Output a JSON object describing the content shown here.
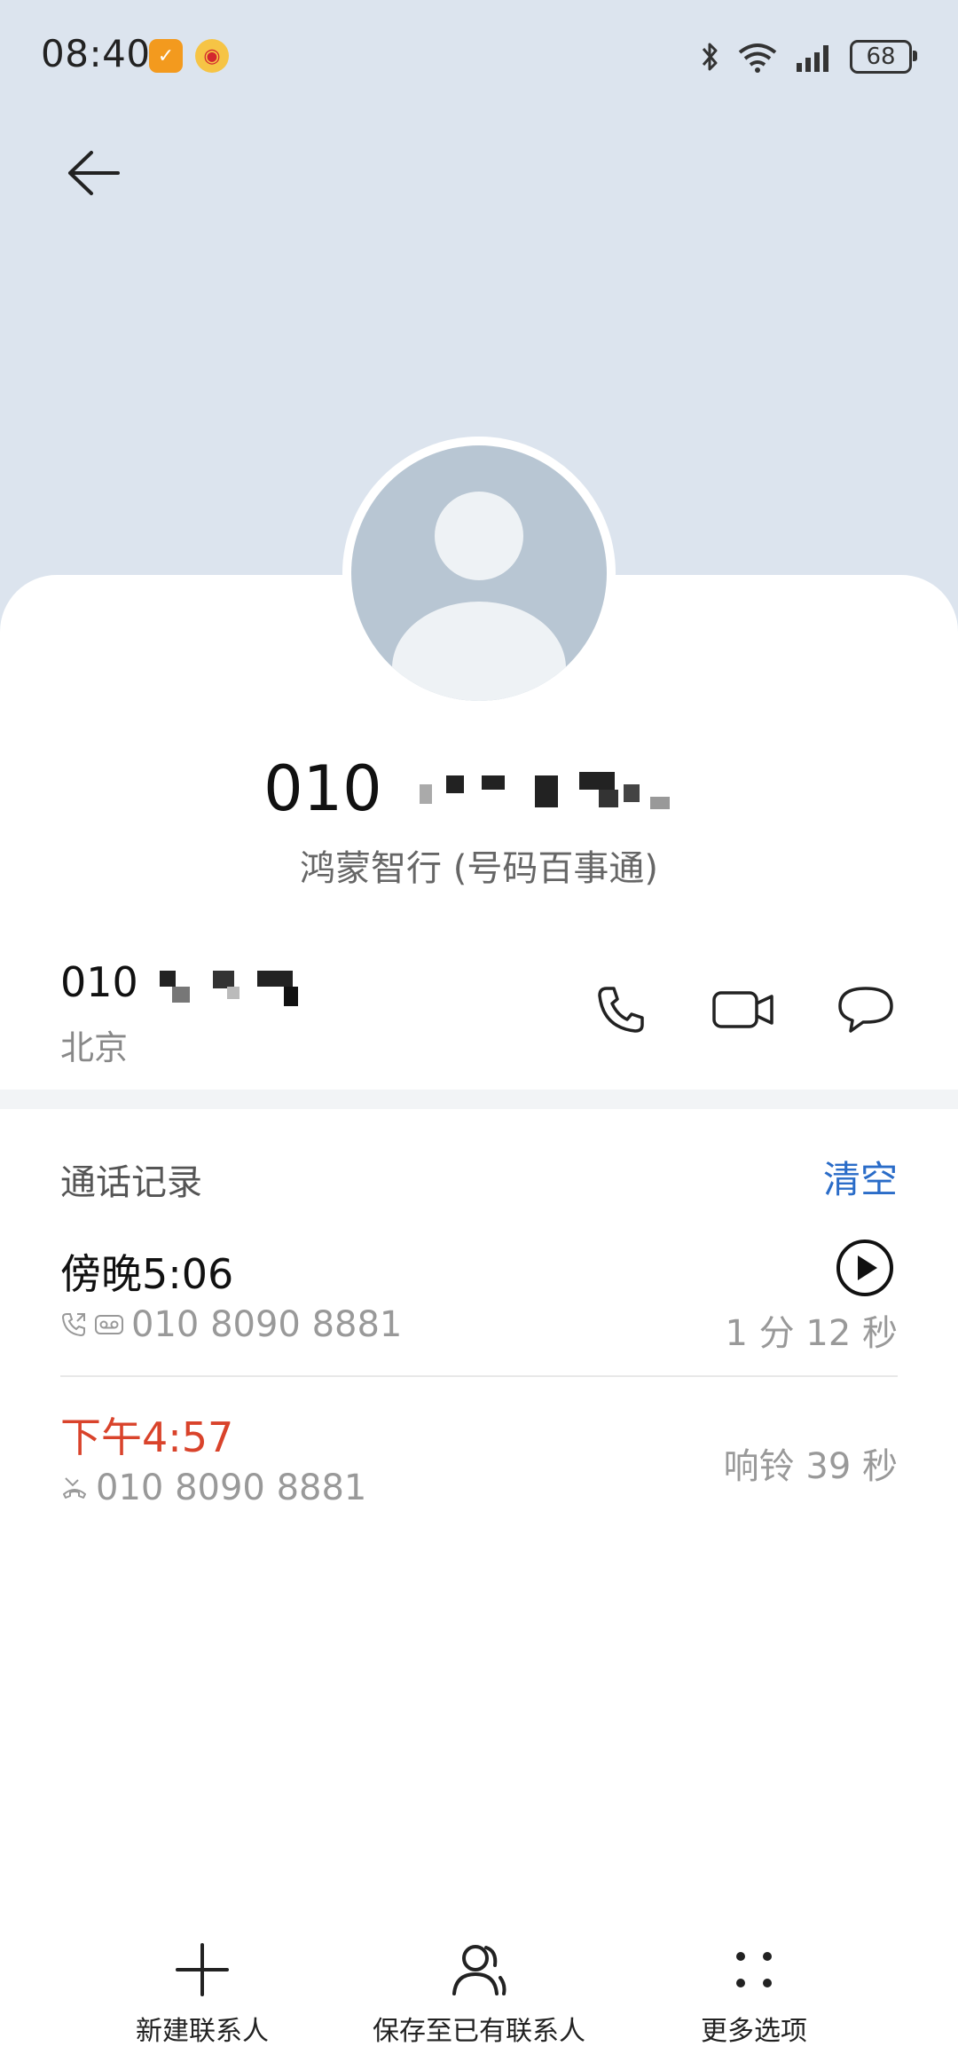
{
  "status_bar": {
    "time": "08:40",
    "battery": "68",
    "icons": [
      "app-notification-icon",
      "weibo-icon",
      "bluetooth-icon",
      "wifi-icon",
      "signal-icon",
      "battery-icon"
    ]
  },
  "header": {
    "back_icon": "back-arrow-icon",
    "background_color": "#dce4ee"
  },
  "contact": {
    "number_display": "010",
    "org_label": "鸿蒙智行 (号码百事通)"
  },
  "number_row": {
    "number": "010",
    "location": "北京",
    "actions": [
      "phone-icon",
      "video-call-icon",
      "message-icon"
    ]
  },
  "call_log": {
    "title": "通话记录",
    "clear_label": "清空",
    "records": [
      {
        "time": "傍晚5:06",
        "number": "010 8090 8881",
        "duration": "1 分 12 秒",
        "type_icons": [
          "outgoing-call-icon",
          "voicemail-icon"
        ],
        "has_play": true
      },
      {
        "time": "下午4:57",
        "number": "010 8090 8881",
        "duration": "响铃 39 秒",
        "type_icons": [
          "missed-call-icon"
        ],
        "missed": true
      }
    ]
  },
  "bottom_bar": {
    "new_contact": "新建联系人",
    "save_existing": "保存至已有联系人",
    "more_options": "更多选项"
  },
  "colors": {
    "accent": "#2a6cc8",
    "missed": "#d9432b"
  }
}
